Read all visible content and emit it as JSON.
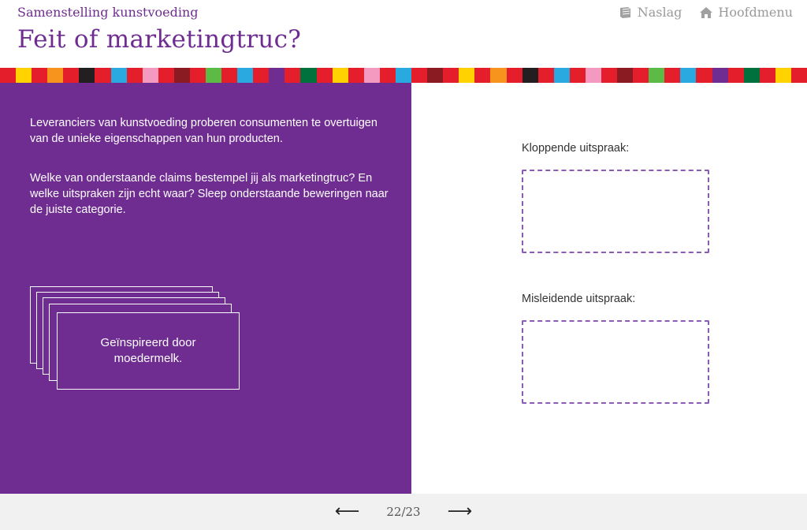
{
  "header": {
    "subtitle": "Samenstelling kunstvoeding",
    "title": "Feit of marketingtruc?",
    "nav": [
      {
        "label": "Naslag",
        "icon": "book-icon"
      },
      {
        "label": "Hoofdmenu",
        "icon": "home-icon"
      }
    ]
  },
  "stripe_colors": [
    "#e41e2b",
    "#ffd200",
    "#e41e2b",
    "#f7941d",
    "#e41e2b",
    "#231f20",
    "#e41e2b",
    "#29a9e0",
    "#e41e2b",
    "#f49ac1",
    "#e41e2b",
    "#8b1b22",
    "#e41e2b",
    "#5bbb46",
    "#e41e2b",
    "#29a9e0",
    "#e41e2b",
    "#6f2c91",
    "#e41e2b",
    "#00703c",
    "#e41e2b",
    "#ffd200",
    "#e41e2b",
    "#f49ac1",
    "#e41e2b",
    "#29a9e0",
    "#e41e2b",
    "#8b1b22",
    "#e41e2b",
    "#ffd200",
    "#e41e2b",
    "#f7941d",
    "#e41e2b",
    "#231f20",
    "#e41e2b",
    "#29a9e0",
    "#e41e2b",
    "#f49ac1",
    "#e41e2b",
    "#8b1b22",
    "#e41e2b",
    "#5bbb46",
    "#e41e2b",
    "#29a9e0",
    "#e41e2b",
    "#6f2c91",
    "#e41e2b",
    "#00703c",
    "#e41e2b",
    "#ffd200",
    "#e41e2b"
  ],
  "left": {
    "intro": "Leveranciers van kunstvoeding proberen consumenten te overtuigen van de unieke eigenschappen van hun producten.",
    "question": "Welke van onderstaande claims bestempel jij als marketingtruc? En welke uitspraken zijn echt waar? Sleep onderstaande beweringen naar de juiste categorie.",
    "card_text": "Geïnspireerd door moedermelk."
  },
  "right": {
    "correct_label": "Kloppende uitspraak:",
    "misleading_label": "Misleidende uitspraak:"
  },
  "footer": {
    "prev": "⟵",
    "page": "22/23",
    "next": "⟶"
  },
  "colors": {
    "purple": "#6f2c91",
    "dropzone_border": "#8b5bb5"
  }
}
